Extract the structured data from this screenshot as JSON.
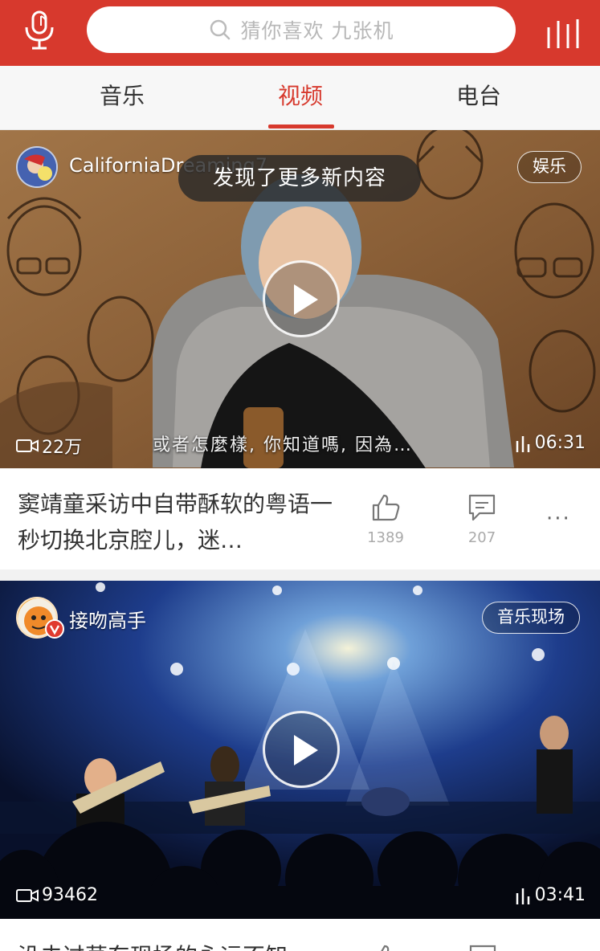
{
  "header": {
    "search_placeholder": "猜你喜欢 九张机",
    "icons": [
      "mic-icon",
      "search-icon",
      "equalizer-icon"
    ],
    "accent_color": "#d7392d"
  },
  "tabs": [
    {
      "label": "音乐",
      "active": false
    },
    {
      "label": "视频",
      "active": true
    },
    {
      "label": "电台",
      "active": false
    }
  ],
  "toast": "发现了更多新内容",
  "videos": [
    {
      "author": "CaliforniaDreaming7",
      "tag": "娱乐",
      "subtitle": "或者怎麼樣, 你知道嗎, 因為…",
      "views": "22万",
      "duration": "06:31",
      "title": "窦靖童采访中自带酥软的粤语一秒切换北京腔儿，迷…",
      "likes": "1389",
      "comments": "207",
      "more": "···"
    },
    {
      "author": "接吻高手",
      "tag": "音乐现场",
      "views": "93462",
      "duration": "03:41",
      "title": "没去过草东现场的永远不知"
    }
  ]
}
